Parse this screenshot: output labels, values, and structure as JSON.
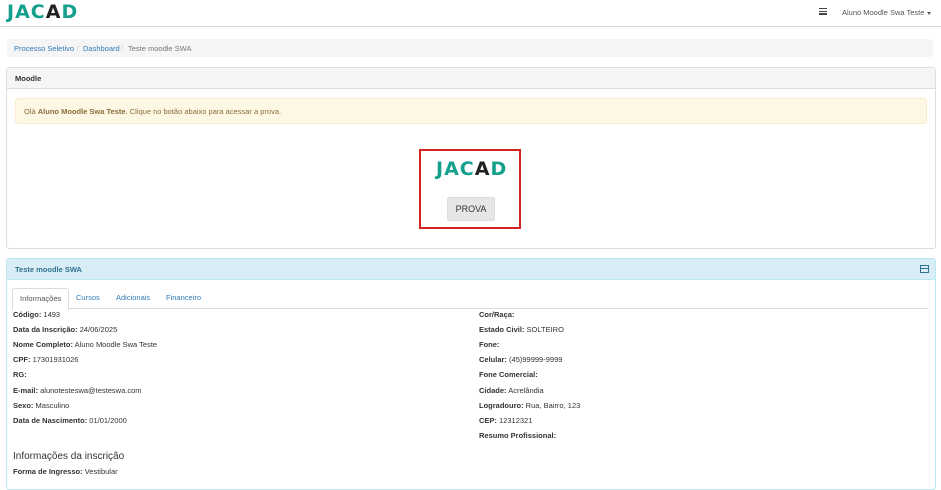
{
  "header": {
    "logo_left": "JAC",
    "logo_slash": "A",
    "logo_right": "D",
    "user_name": "Aluno Moodle Swa Teste"
  },
  "breadcrumb": {
    "items": [
      "Processo Seletivo",
      "Dashboard",
      "Teste moodle SWA"
    ],
    "separator": "/"
  },
  "moodle_panel": {
    "title": "Moodle",
    "alert_prefix": "Olá ",
    "alert_name": "Aluno Moodle Swa Teste",
    "alert_suffix": ". Clique no botão abaixo para acessar a prova.",
    "button_label": "PROVA"
  },
  "info_panel": {
    "title": "Teste moodle SWA",
    "tabs": [
      {
        "label": "Informações",
        "active": true
      },
      {
        "label": "Cursos",
        "active": false
      },
      {
        "label": "Adicionais",
        "active": false
      },
      {
        "label": "Financeiro",
        "active": false
      }
    ],
    "left_fields": [
      {
        "label": "Código:",
        "value": "1493"
      },
      {
        "label": "Data da Inscrição:",
        "value": "24/06/2025"
      },
      {
        "label": "Nome Completo:",
        "value": "Aluno Moodle Swa Teste"
      },
      {
        "label": "CPF:",
        "value": "17301931026"
      },
      {
        "label": "RG:",
        "value": ""
      },
      {
        "label": "E-mail:",
        "value": "alunotesteswa@testeswa.com"
      },
      {
        "label": "Sexo:",
        "value": "Masculino"
      },
      {
        "label": "Data de Nascimento:",
        "value": "01/01/2000"
      }
    ],
    "right_fields": [
      {
        "label": "Cor/Raça:",
        "value": ""
      },
      {
        "label": "Estado Civil:",
        "value": "SOLTEIRO"
      },
      {
        "label": "Fone:",
        "value": ""
      },
      {
        "label": "Celular:",
        "value": "(45)99999-9999"
      },
      {
        "label": "Fone Comercial:",
        "value": ""
      },
      {
        "label": "Cidade:",
        "value": "Acrelândia"
      },
      {
        "label": "Logradouro:",
        "value": "Rua, Bairro, 123"
      },
      {
        "label": "CEP:",
        "value": "12312321"
      },
      {
        "label": "Resumo Profissional:",
        "value": ""
      }
    ],
    "section_title": "Informações da inscrição",
    "ingresso": {
      "label": "Forma de Ingresso:",
      "value": "Vestibular"
    }
  },
  "colors": {
    "brand": "#14a08d",
    "link": "#337ab7",
    "highlight_border": "#d32222"
  }
}
